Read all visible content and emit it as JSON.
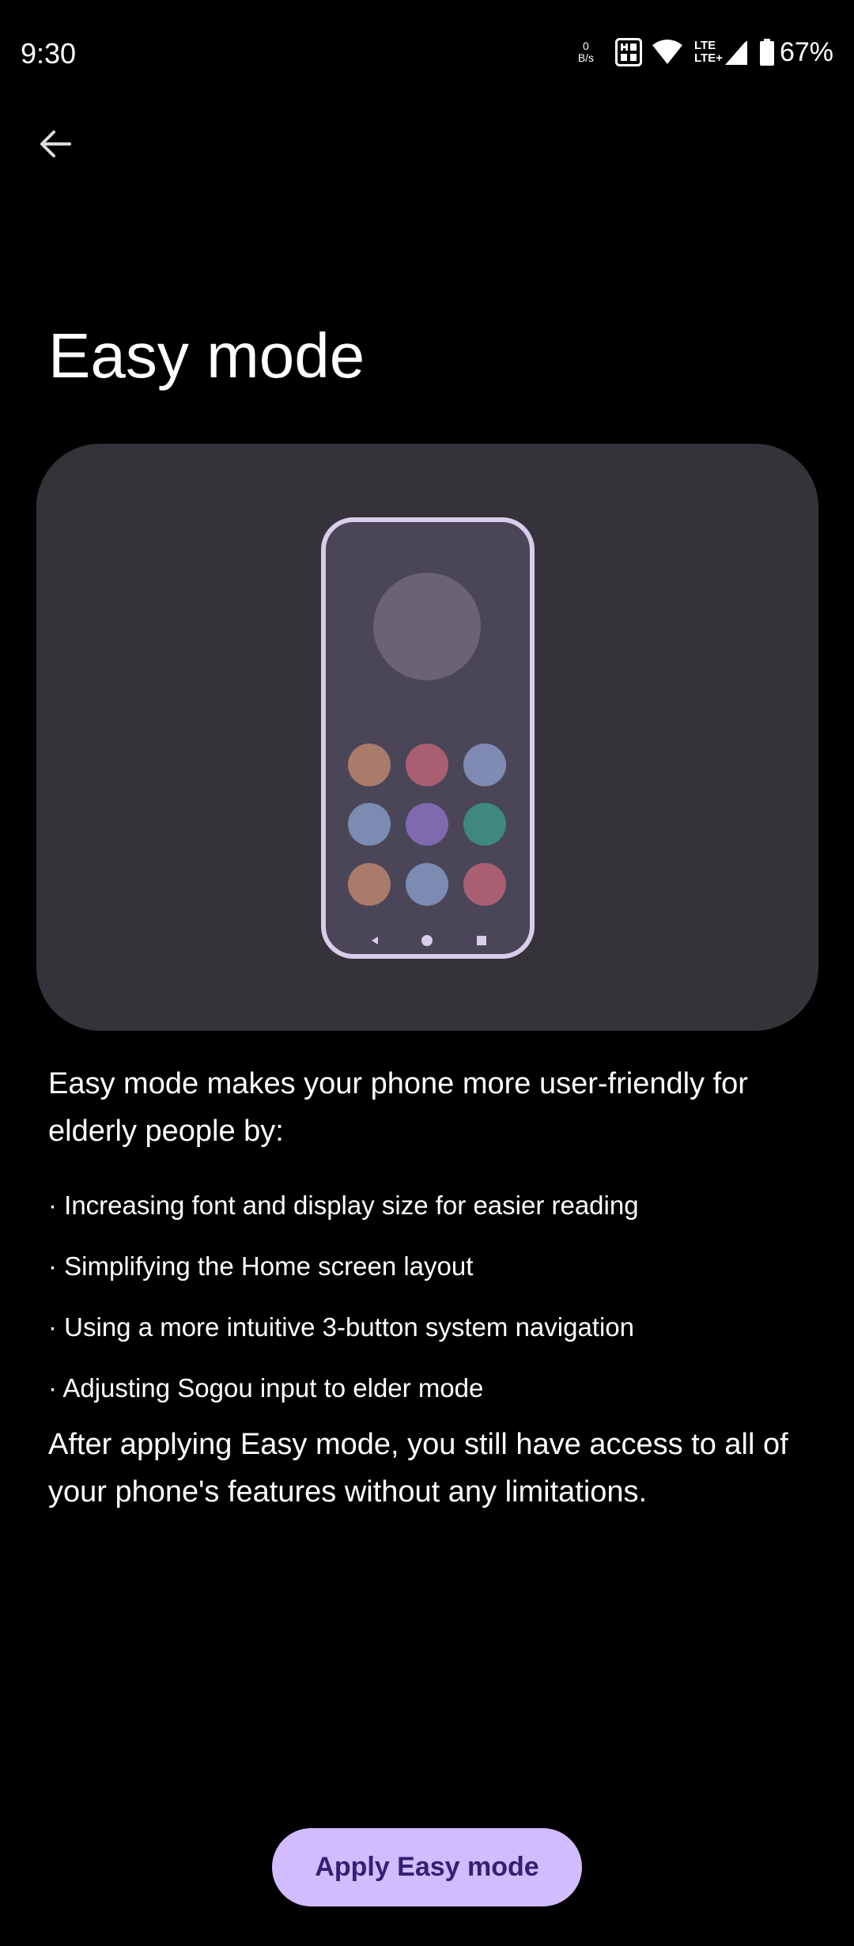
{
  "status_bar": {
    "time": "9:30",
    "net_speed_value": "0",
    "net_speed_unit": "B/s",
    "lte_top": "LTE",
    "lte_bottom": "LTE+",
    "battery": "67%"
  },
  "header": {
    "back_icon": "arrow-back-icon",
    "title": "Easy mode"
  },
  "illustration": {
    "colors": {
      "card": "#353339",
      "phone_frame": "#d8cdea",
      "phone_screen": "#4b4558",
      "big_circle": "#6a6375"
    },
    "app_dot_colors": [
      "#a97b6b",
      "#a95f71",
      "#7f8bb3",
      "#7b8bb2",
      "#7f6aaf",
      "#3f8880",
      "#a97b6b",
      "#7b8bb2",
      "#a95f71"
    ],
    "nav_icons": [
      "back-triangle-icon",
      "home-circle-icon",
      "recents-square-icon"
    ]
  },
  "content": {
    "description": "Easy mode makes your phone more user-friendly for elderly people by:",
    "bullets": [
      "· Increasing font and display size for easier reading",
      "· Simplifying the Home screen layout",
      "· Using a more intuitive 3-button system navigation",
      "· Adjusting Sogou input to elder mode"
    ],
    "after_text": "After applying Easy mode, you still have access to all of your phone's features without any limitations."
  },
  "actions": {
    "apply_label": "Apply Easy mode",
    "apply_color": "#d0bcff",
    "apply_text_color": "#381e72"
  }
}
